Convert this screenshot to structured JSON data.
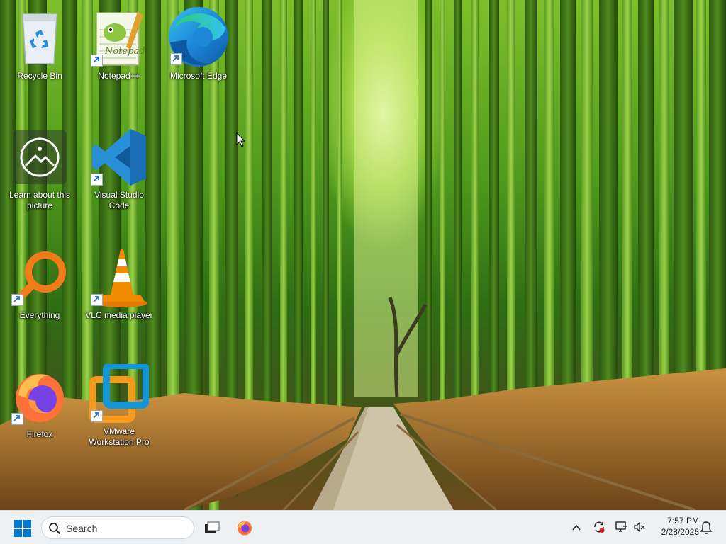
{
  "desktop": {
    "icons": [
      {
        "label": "Recycle Bin",
        "icon": "recycle-bin-icon",
        "shortcut": false
      },
      {
        "label": "Notepad++",
        "icon": "notepadpp-icon",
        "shortcut": true
      },
      {
        "label": "Microsoft Edge",
        "icon": "edge-icon",
        "shortcut": true
      },
      {
        "label": "Learn about this picture",
        "icon": "learn-picture-icon",
        "shortcut": false
      },
      {
        "label": "Visual Studio Code",
        "icon": "vscode-icon",
        "shortcut": true
      },
      {
        "label": "Everything",
        "icon": "everything-search-icon",
        "shortcut": true
      },
      {
        "label": "VLC media player",
        "icon": "vlc-icon",
        "shortcut": true
      },
      {
        "label": "Firefox",
        "icon": "firefox-icon",
        "shortcut": true
      },
      {
        "label": "VMware Workstation Pro",
        "icon": "vmware-icon",
        "shortcut": true
      }
    ]
  },
  "taskbar": {
    "search_label": "Search",
    "pinned": [
      {
        "name": "task-view",
        "icon": "task-view-icon"
      },
      {
        "name": "firefox",
        "icon": "firefox-icon"
      }
    ],
    "tray": {
      "time": "7:57 PM",
      "date": "2/28/2025"
    }
  },
  "colors": {
    "taskbar_bg": "#eef1f4",
    "windows_blue": "#0078d4",
    "edge_blue": "#1e88d8",
    "vscode_blue": "#2a8fd9",
    "vlc_orange": "#f08a00",
    "everything_orange": "#f27b1a",
    "vmware_orange": "#f59a1a"
  }
}
